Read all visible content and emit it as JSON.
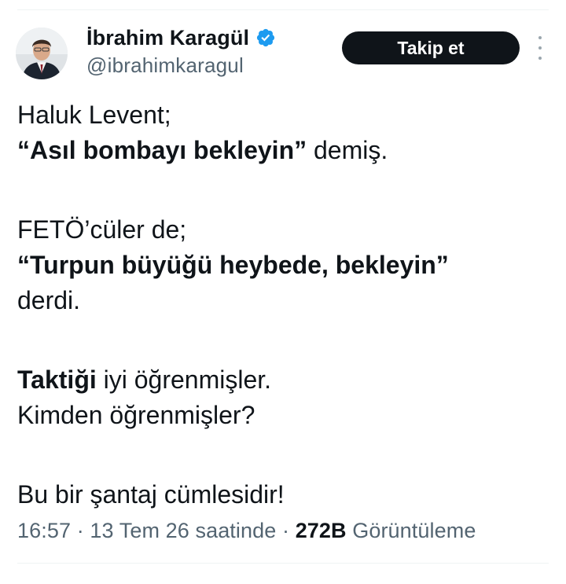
{
  "author": {
    "display_name": "İbrahim Karagül",
    "handle": "@ibrahimkaragul",
    "verified_icon": "verified-badge-icon"
  },
  "follow_button": {
    "label": "Takip et"
  },
  "tweet": {
    "line1": "Haluk Levent;",
    "line2_bold": "“Asıl bombayı bekleyin”",
    "line2_rest": " demiş.",
    "line3": "FETÖ’cüler de;",
    "line4_bold": "“Turpun büyüğü heybede, bekleyin”",
    "line5": "derdi.",
    "line6_bold": "Taktiği",
    "line6_rest": " iyi öğrenmişler.",
    "line7": "Kimden öğrenmişler?",
    "line8": "Bu bir şantaj cümlesidir!"
  },
  "meta": {
    "time": "16:57",
    "separator": "·",
    "date": "13 Tem 26 saatinde",
    "views_count": "272B",
    "views_label": "Görüntüleme"
  },
  "colors": {
    "text": "#0f1419",
    "secondary_text": "#536471",
    "verified_blue": "#1d9bf0",
    "button_bg": "#0f1419"
  }
}
